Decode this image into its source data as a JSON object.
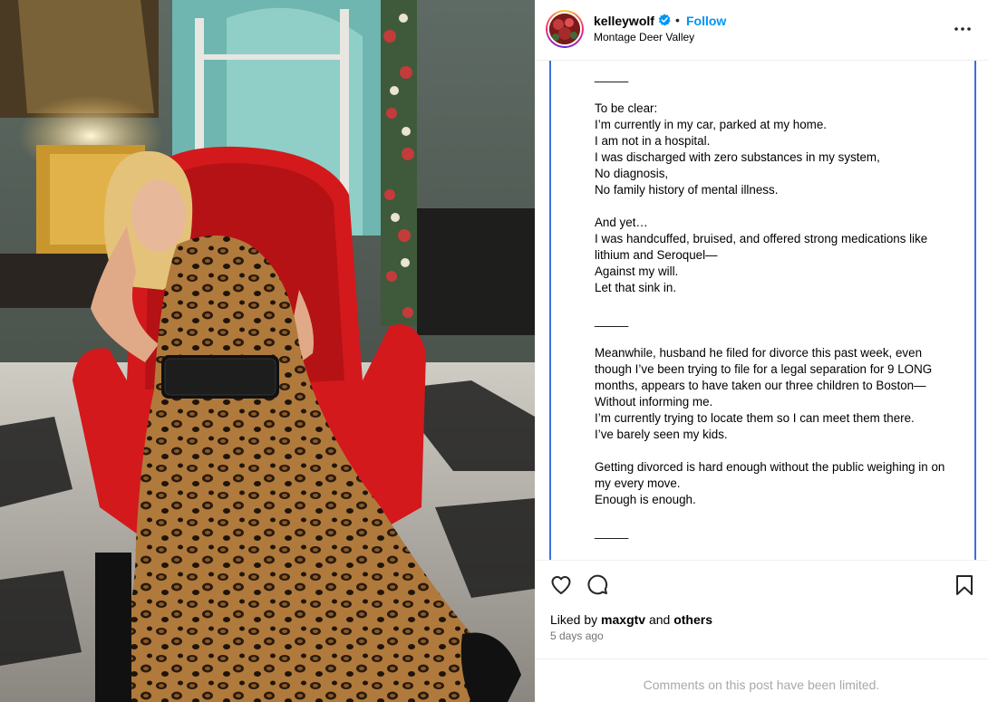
{
  "post": {
    "username": "kelleywolf",
    "follow_label": "Follow",
    "separator": "•",
    "location": "Montage Deer Valley"
  },
  "caption": {
    "text": "_____\n\nTo be clear:\nI’m currently in my car, parked at my home.\nI am not in a hospital.\nI was discharged with zero substances in my system,\nNo diagnosis,\nNo family history of mental illness.\n\nAnd yet…\nI was handcuffed, bruised, and offered strong medications like lithium and Seroquel—\nAgainst my will.\nLet that sink in.\n\n_____\n\nMeanwhile, husband he filed for divorce this past week, even though I’ve been trying to file for a legal separation for 9 LONG months, appears to have taken our three children to Boston—\nWithout informing me.\nI’m currently trying to locate them so I can meet them there.\nI’ve barely seen my kids.\n\nGetting divorced is hard enough without the public weighing in on my every move.\nEnough is enough.\n\n_____"
  },
  "engagement": {
    "liked_by_prefix": "Liked by ",
    "liked_by_user": "maxgtv",
    "liked_by_middle": " and ",
    "liked_by_others": "others",
    "time_ago": "5 days ago"
  },
  "comments_notice": "Comments on this post have been limited.",
  "icons": {
    "verified": "verified-badge-icon",
    "more": "more-options-icon",
    "like": "heart-icon",
    "comment": "comment-icon",
    "save": "bookmark-icon"
  },
  "colors": {
    "accent": "#0095f6",
    "caption_border": "#3a72d4",
    "muted": "#737373",
    "disabled": "#a8a8a8"
  }
}
